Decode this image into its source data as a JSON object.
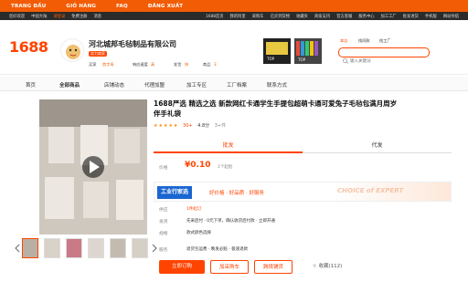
{
  "topnav": {
    "items": [
      "TRANG ĐẦU",
      "GIỎ HÀNG",
      "FAQ",
      "ĐĂNG XUẤT"
    ]
  },
  "sitebar": {
    "items": [
      "您好欢迎",
      "中国大陆",
      "请登录",
      "免费注册",
      "消息"
    ],
    "right_items": [
      "1688首页",
      "我的阿里",
      "采购车",
      "已买到货物",
      "收藏夹",
      "商家支持",
      "官方客服",
      "服务中心",
      "加工工厂",
      "批发进货",
      "手机版",
      "网站导航"
    ]
  },
  "header": {
    "logo": "1688",
    "shop_name": "河北城邦毛毡制品有限公司",
    "service_badge": "实力商家",
    "stats": [
      {
        "label": "买家",
        "value": "首字母"
      },
      {
        "label": "响应速度",
        "value": "高"
      },
      {
        "label": "发货",
        "value": "快"
      },
      {
        "label": "商品",
        "value": "3"
      }
    ],
    "search_placeholder": "输入关键词",
    "search_tabs": [
      "本店",
      "找同款",
      "找工厂"
    ]
  },
  "secnav": {
    "items": [
      "首页",
      "全部商品",
      "店铺动态",
      "代理加盟",
      "加工专区",
      "工厂档案",
      "联系方式"
    ]
  },
  "product": {
    "title": "1688严选 精选之选 新款网红卡通学生手提包超萌卡通可爱兔子毛毡包满月周岁伴手礼袋",
    "rating": "30+",
    "rating_extra": "4.8分",
    "sales": "3+件",
    "tab_wholesale": "批发",
    "tab_dropship": "代发",
    "price_label": "价格",
    "price": "¥0.10",
    "price_unit": "1个起批",
    "factory_label": "工业行家选",
    "factory_slogan": "好价格 · 好品质 · 好服务",
    "factory_en": "CHOICE of EXPERT",
    "shipping_label": "发货",
    "shipping_value": "先采后付 · 0元下单，确认收货后付款 · 立即开通",
    "service_label": "服务",
    "service_value": "退货包运费 · 晚发必赔 · 极速退款",
    "spec_label": "规格",
    "spec_value": "款式颜色选择",
    "supply_label": "供应",
    "supply_value": "1件起订"
  },
  "actions": {
    "buy": "立即订购",
    "cart": "加采购车",
    "dropship": "跨境铺货",
    "favorite": "收藏(112)"
  },
  "gallery": {
    "thumbs_count": "6"
  },
  "colors": {
    "brand": "#ff4400",
    "topnav": "#f25c05",
    "factory_blue": "#1a66d1"
  }
}
